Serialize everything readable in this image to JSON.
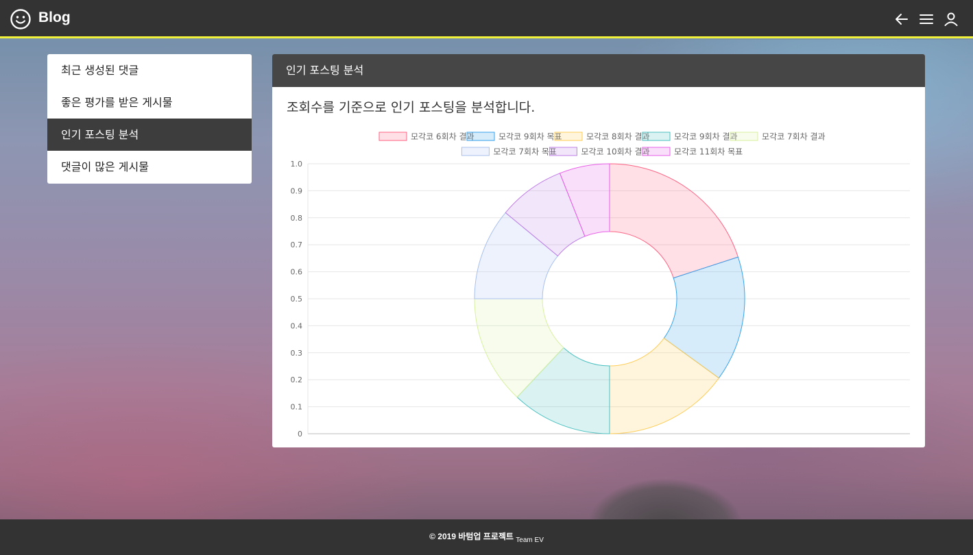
{
  "header": {
    "brand": "Blog",
    "icons": [
      "smile-icon",
      "back-arrow-icon",
      "menu-icon",
      "user-icon"
    ]
  },
  "sidebar": {
    "items": [
      {
        "label": "최근 생성된 댓글",
        "active": false
      },
      {
        "label": "좋은 평가를 받은 게시물",
        "active": false
      },
      {
        "label": "인기 포스팅 분석",
        "active": true
      },
      {
        "label": "댓글이 많은 게시물",
        "active": false
      }
    ]
  },
  "card": {
    "title": "인기 포스팅 분석",
    "description": "조회수를 기준으로 인기 포스팅을 분석합니다."
  },
  "chart_data": {
    "type": "doughnut",
    "series": [
      {
        "name": "모각코 6회차 결과",
        "value": 0.2,
        "color": "#ff6384"
      },
      {
        "name": "모각코 9회차 목표",
        "value": 0.15,
        "color": "#36a2eb"
      },
      {
        "name": "모각코 8회차 결과",
        "value": 0.15,
        "color": "#ffcd56"
      },
      {
        "name": "모각코 9회차 결과",
        "value": 0.12,
        "color": "#4bc0c0"
      },
      {
        "name": "모각코 7회차 결과",
        "value": 0.13,
        "color": "#d8f0a0"
      },
      {
        "name": "모각코 7회차 목표",
        "value": 0.11,
        "color": "#a8c0ee"
      },
      {
        "name": "모각코 10회차 결과",
        "value": 0.08,
        "color": "#c080e8"
      },
      {
        "name": "모각코 11회차 목표",
        "value": 0.06,
        "color": "#e860e8"
      }
    ],
    "y_ticks": [
      "1.0",
      "0.9",
      "0.8",
      "0.7",
      "0.6",
      "0.5",
      "0.4",
      "0.3",
      "0.2",
      "0.1",
      "0"
    ],
    "ylim": [
      0,
      1
    ],
    "grid": true,
    "legend_position": "top"
  },
  "footer": {
    "copyright": "© 2019 바텀업 프로젝트",
    "team": "Team EV"
  }
}
